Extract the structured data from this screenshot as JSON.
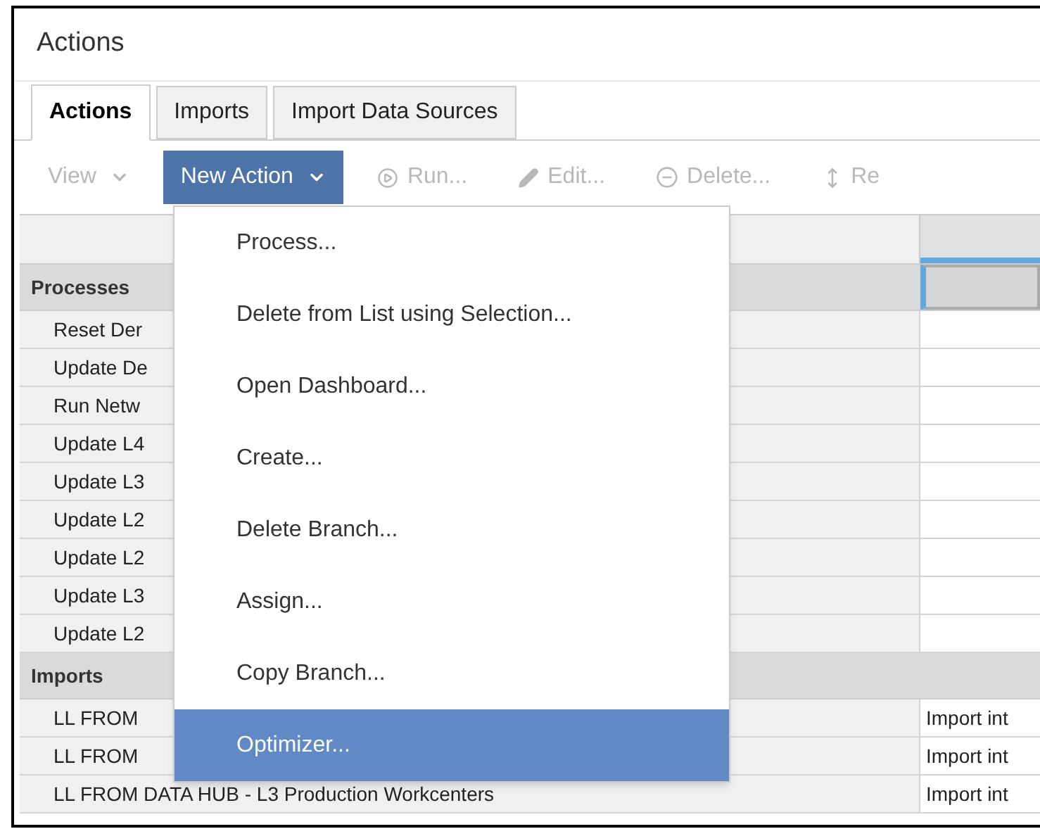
{
  "panel": {
    "title": "Actions"
  },
  "tabs": [
    {
      "label": "Actions",
      "selected": true
    },
    {
      "label": "Imports",
      "selected": false
    },
    {
      "label": "Import Data Sources",
      "selected": false
    }
  ],
  "toolbar": [
    {
      "kind": "dropdown",
      "label": "View",
      "disabled": true
    },
    {
      "kind": "dropdown",
      "label": "New Action",
      "disabled": false,
      "open": true
    },
    {
      "kind": "run",
      "label": "Run...",
      "disabled": true
    },
    {
      "kind": "edit",
      "label": "Edit...",
      "disabled": true
    },
    {
      "kind": "delete",
      "label": "Delete...",
      "disabled": true
    },
    {
      "kind": "reorder",
      "label": "Re",
      "disabled": true
    }
  ],
  "menu": [
    {
      "label": "Process...",
      "selected": false
    },
    {
      "label": "Delete from List using Selection...",
      "selected": false
    },
    {
      "label": "Open Dashboard...",
      "selected": false
    },
    {
      "label": "Create...",
      "selected": false
    },
    {
      "label": "Delete Branch...",
      "selected": false
    },
    {
      "label": "Assign...",
      "selected": false
    },
    {
      "label": "Copy Branch...",
      "selected": false
    },
    {
      "label": "Optimizer...",
      "selected": true
    }
  ],
  "groups": [
    {
      "name": "Processes",
      "rows": [
        {
          "name": "Reset Der"
        },
        {
          "name": "Update De"
        },
        {
          "name": "Run Netw"
        },
        {
          "name": "Update L4"
        },
        {
          "name": "Update L3"
        },
        {
          "name": "Update L2"
        },
        {
          "name": "Update L2"
        },
        {
          "name": "Update L3"
        },
        {
          "name": "Update L2"
        }
      ]
    },
    {
      "name": "Imports",
      "rows": [
        {
          "name": "LL FROM",
          "column_2": "Import int"
        },
        {
          "name": "LL FROM",
          "column_2": "Import int"
        },
        {
          "name": "LL FROM DATA HUB - L3 Production Workcenters",
          "column_2": "Import int"
        }
      ]
    }
  ]
}
